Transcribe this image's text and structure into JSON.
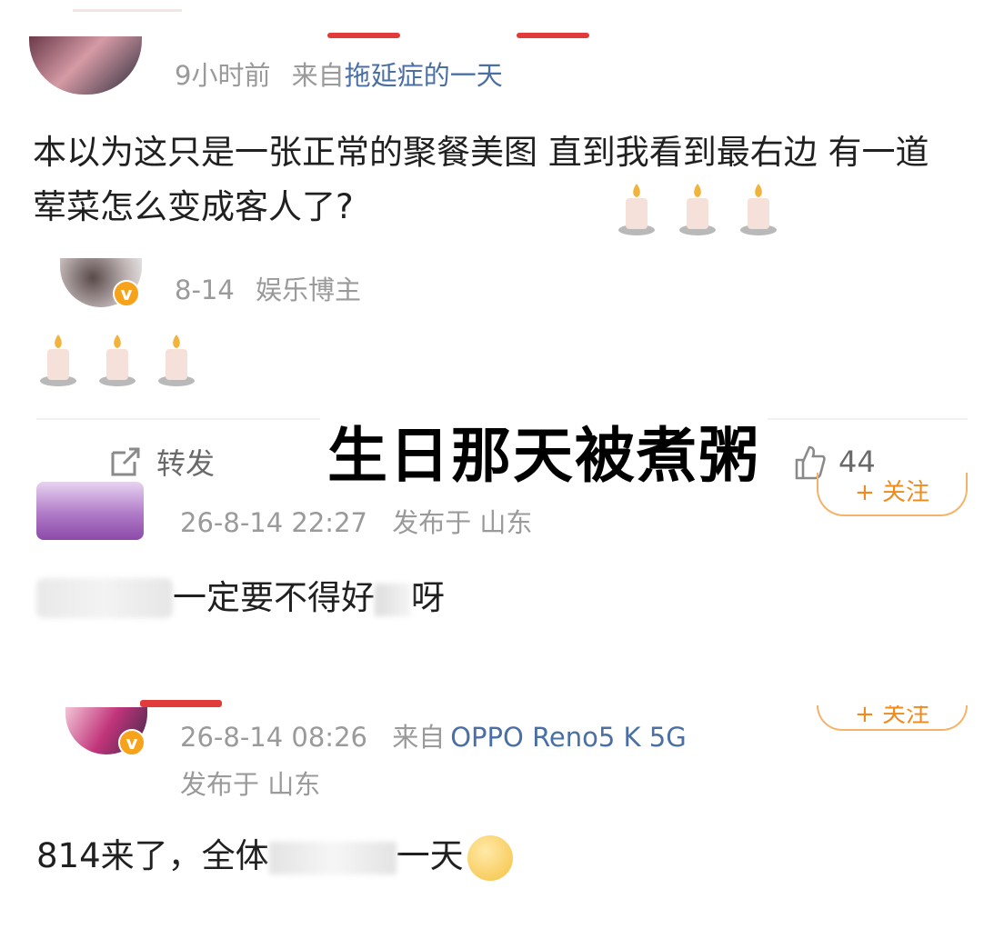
{
  "comment1": {
    "time": "9小时前",
    "source_prefix": "来自",
    "source_link": "拖延症的一天",
    "text": "本以为这只是一张正常的聚餐美图 直到我看到最右边 有一道荤菜怎么变成客人了?"
  },
  "comment2": {
    "time": "8-14",
    "role": "娱乐博主",
    "badge": "v"
  },
  "action_bar": {
    "repost_label": "转发",
    "like_count": "44",
    "icons": [
      "repost-icon",
      "like-icon"
    ]
  },
  "overlay_caption": "生日那天被煮粥",
  "comment3": {
    "time": "26-8-14 22:27",
    "location": "发布于 山东",
    "text_visible": "一定要不得好",
    "text_tail": "呀",
    "follow_label": "+ 关注"
  },
  "comment4": {
    "time": "26-8-14 08:26",
    "source_prefix": "来自",
    "source_link": "OPPO Reno5 K 5G",
    "location": "发布于 山东",
    "text_start": "814来了，全体",
    "text_end": "一天",
    "badge": "v",
    "follow_label": "+ 关注"
  },
  "colors": {
    "meta": "#9a9a9a",
    "link": "#4a6fa5",
    "badge": "#f7a21b",
    "follow": "#f08a1c"
  }
}
